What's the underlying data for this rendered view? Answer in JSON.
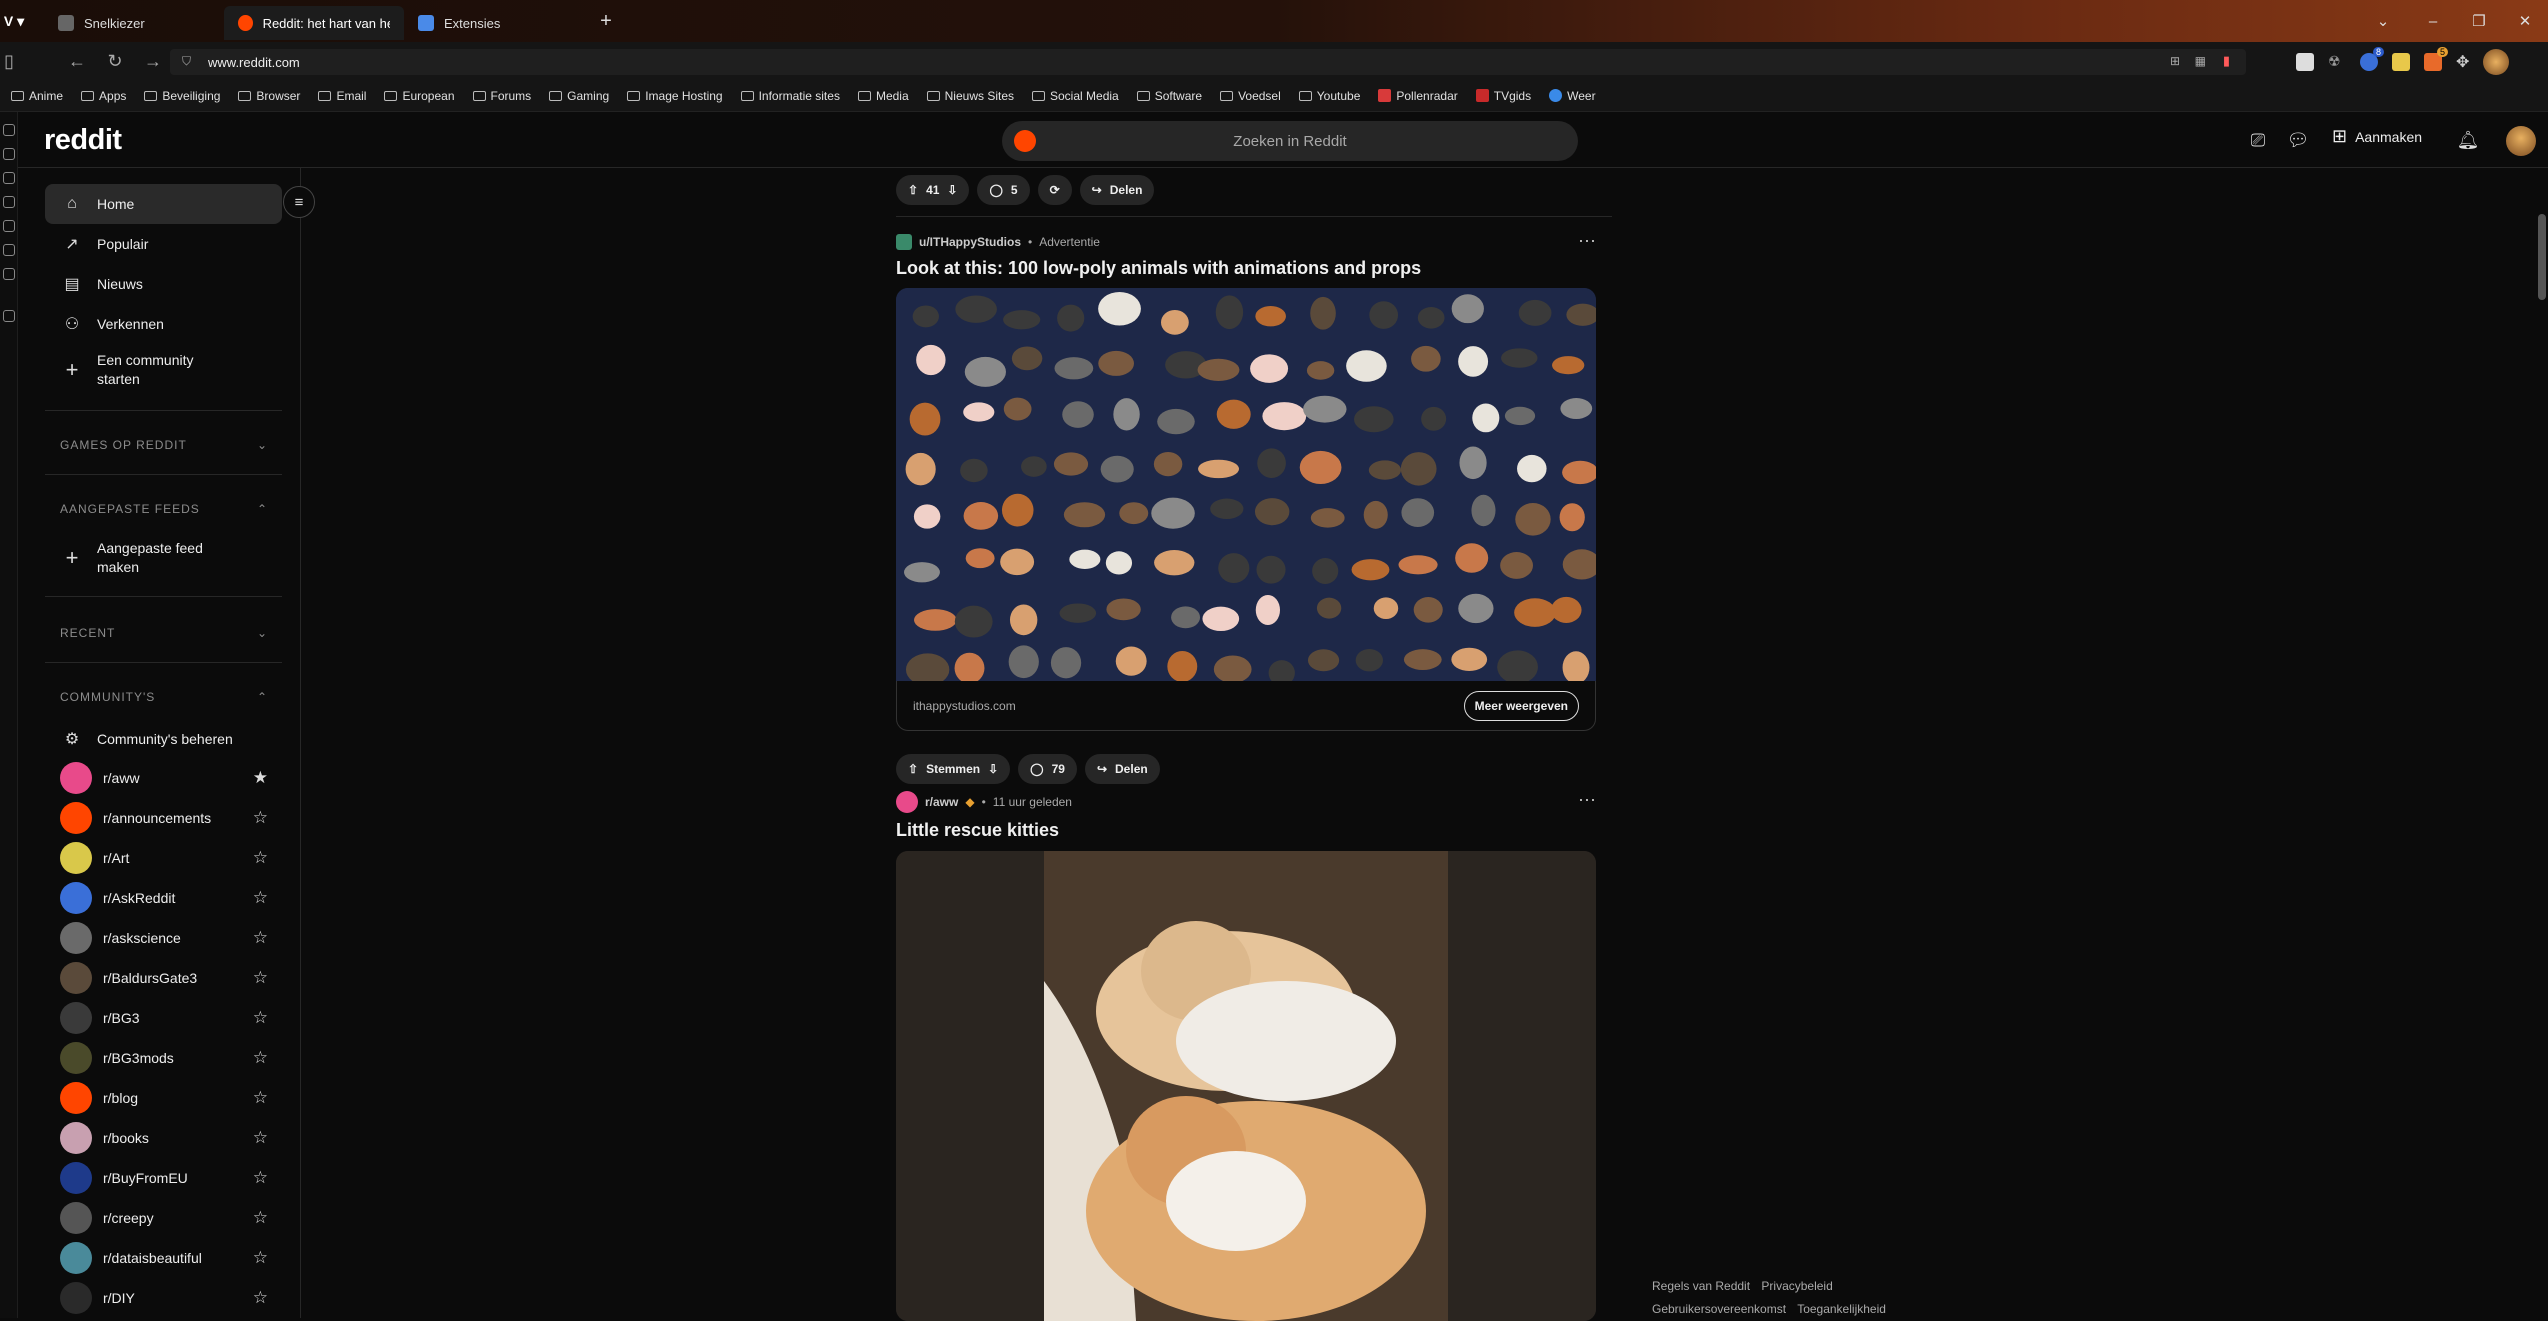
{
  "browser": {
    "tabs": [
      {
        "label": "Snelkiezer"
      },
      {
        "label": "Reddit: het hart van het int"
      },
      {
        "label": "Extensies"
      }
    ],
    "url": "www.reddit.com",
    "bookmarks": [
      "Anime",
      "Apps",
      "Beveiliging",
      "Browser",
      "Email",
      "European",
      "Forums",
      "Gaming",
      "Image Hosting",
      "Informatie sites",
      "Media",
      "Nieuws Sites",
      "Social Media",
      "Software",
      "Voedsel",
      "Youtube",
      "Pollenradar",
      "TVgids",
      "Weer"
    ],
    "extension_badges": {
      "one": "8",
      "two": "5"
    }
  },
  "header": {
    "logo": "reddit",
    "search_placeholder": "Zoeken in Reddit",
    "create_label": "Aanmaken"
  },
  "sidebar": {
    "nav": [
      {
        "label": "Home",
        "icon": "home-icon",
        "active": true
      },
      {
        "label": "Populair",
        "icon": "popular-icon"
      },
      {
        "label": "Nieuws",
        "icon": "news-icon"
      },
      {
        "label": "Verkennen",
        "icon": "explore-icon"
      },
      {
        "label": "Een community starten",
        "icon": "plus-icon"
      }
    ],
    "games_heading": "GAMES OP REDDIT",
    "custom_feeds_heading": "AANGEPASTE FEEDS",
    "custom_feed_create": "Aangepaste feed maken",
    "recent_heading": "RECENT",
    "communities_heading": "COMMUNITY'S",
    "manage_communities": "Community's beheren",
    "communities": [
      {
        "name": "r/aww",
        "color": "#e84a8a",
        "favorite": true
      },
      {
        "name": "r/announcements",
        "color": "#ff4500",
        "favorite": false
      },
      {
        "name": "r/Art",
        "color": "#d9c84a",
        "favorite": false
      },
      {
        "name": "r/AskReddit",
        "color": "#3a6fd8",
        "favorite": false
      },
      {
        "name": "r/askscience",
        "color": "#6a6a6a",
        "favorite": false
      },
      {
        "name": "r/BaldursGate3",
        "color": "#5a4a3a",
        "favorite": false
      },
      {
        "name": "r/BG3",
        "color": "#3a3a3a",
        "favorite": false
      },
      {
        "name": "r/BG3mods",
        "color": "#4a4a2a",
        "favorite": false
      },
      {
        "name": "r/blog",
        "color": "#ff4500",
        "favorite": false
      },
      {
        "name": "r/books",
        "color": "#c8a0b0",
        "favorite": false
      },
      {
        "name": "r/BuyFromEU",
        "color": "#1e3a8a",
        "favorite": false
      },
      {
        "name": "r/creepy",
        "color": "#555555",
        "favorite": false
      },
      {
        "name": "r/dataisbeautiful",
        "color": "#4a8a9a",
        "favorite": false
      },
      {
        "name": "r/DIY",
        "color": "#2a2a2a",
        "favorite": false
      }
    ]
  },
  "feed": {
    "top_bar": {
      "votes": "41",
      "comments": "5",
      "share": "Delen"
    },
    "ad_post": {
      "author": "u/ITHappyStudios",
      "tag": "Advertentie",
      "title": "Look at this: 100 low-poly animals with animations and props",
      "domain": "ithappystudios.com",
      "cta": "Meer weergeven",
      "vote_label": "Stemmen",
      "comments": "79",
      "share": "Delen"
    },
    "post2": {
      "subreddit": "r/aww",
      "time": "11 uur geleden",
      "title": "Little rescue kitties"
    }
  },
  "footer": {
    "links": [
      "Regels van Reddit",
      "Privacybeleid",
      "Gebruikersovereenkomst",
      "Toegankelijkheid"
    ]
  }
}
